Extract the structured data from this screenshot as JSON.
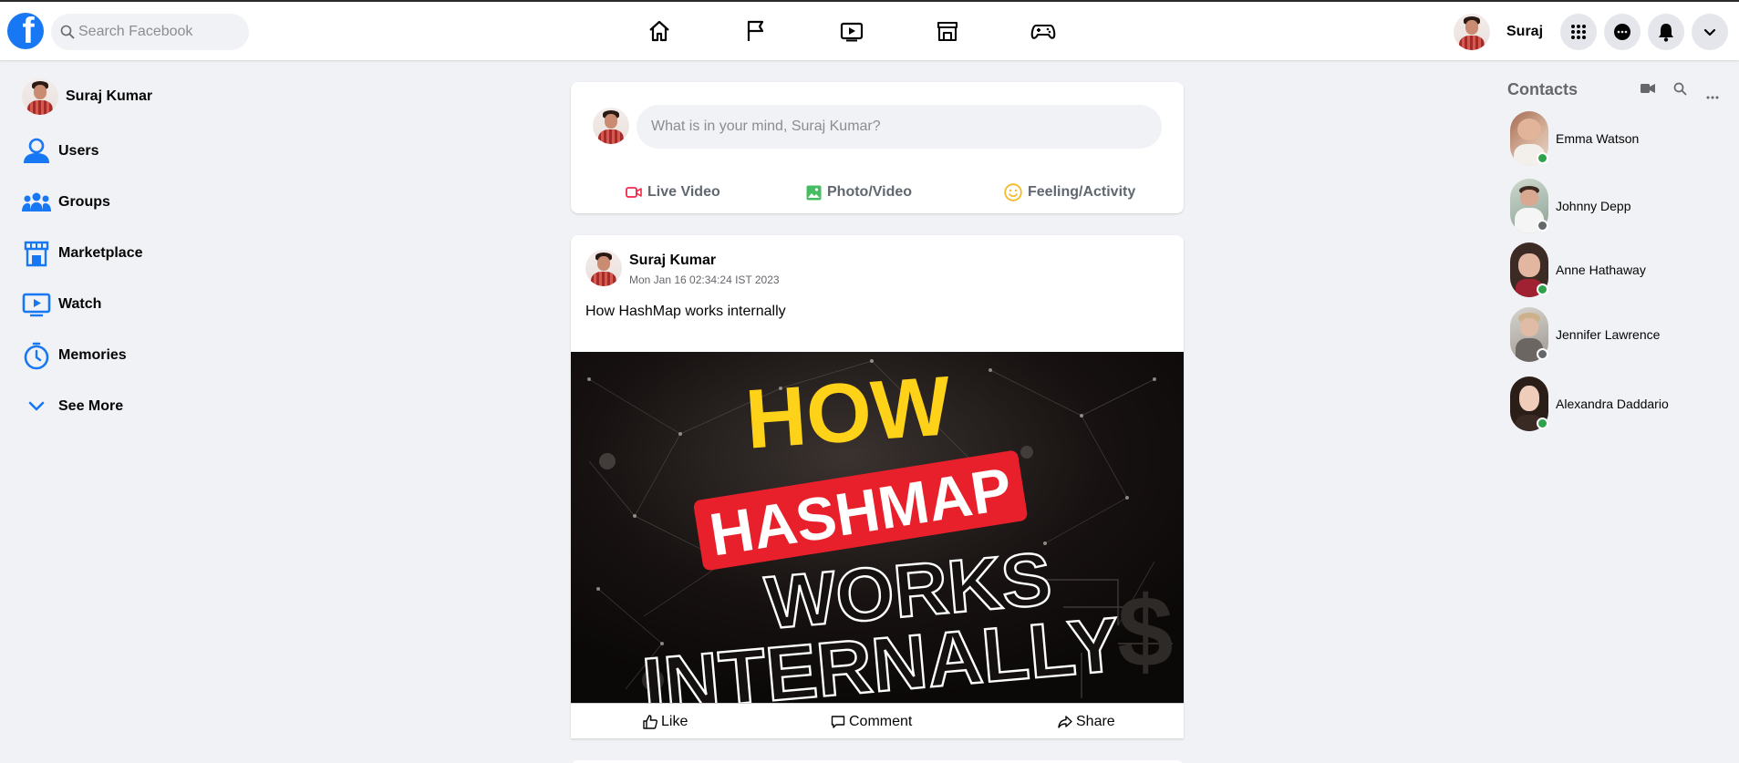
{
  "app": {
    "logo_letter": "f",
    "brand_color": "#1877f2"
  },
  "header": {
    "search": {
      "placeholder": "Search Facebook",
      "value": ""
    },
    "nav_icons": [
      "home-icon",
      "pages-flag-icon",
      "watch-icon",
      "marketplace-icon",
      "gaming-icon"
    ],
    "user_short_name": "Suraj",
    "right_buttons": [
      "menu-grid-icon",
      "messenger-icon",
      "notifications-bell-icon",
      "account-chevron-icon"
    ]
  },
  "sidebar": {
    "profile_name": "Suraj Kumar",
    "items": [
      {
        "label": "Users",
        "icon": "users-icon"
      },
      {
        "label": "Groups",
        "icon": "groups-icon"
      },
      {
        "label": "Marketplace",
        "icon": "marketplace-icon"
      },
      {
        "label": "Watch",
        "icon": "watch-icon"
      },
      {
        "label": "Memories",
        "icon": "memories-clock-icon"
      },
      {
        "label": "See More",
        "icon": "chevron-down-icon"
      }
    ]
  },
  "composer": {
    "placeholder": "What is in your mind, Suraj Kumar?",
    "actions": [
      {
        "label": "Live Video",
        "icon": "live-video-icon",
        "color": "#f02849"
      },
      {
        "label": "Photo/Video",
        "icon": "photo-icon",
        "color": "#45bd62"
      },
      {
        "label": "Feeling/Activity",
        "icon": "feeling-smiley-icon",
        "color": "#f7b928"
      }
    ]
  },
  "post": {
    "author": "Suraj Kumar",
    "timestamp": "Mon Jan 16 02:34:24 IST 2023",
    "text": "How HashMap works internally",
    "image_lines": [
      "HOW",
      "HASHMAP",
      "WORKS",
      "INTERNALLY"
    ],
    "actions": [
      {
        "label": "Like",
        "icon": "like-thumb-icon"
      },
      {
        "label": "Comment",
        "icon": "comment-icon"
      },
      {
        "label": "Share",
        "icon": "share-icon"
      }
    ]
  },
  "contacts": {
    "title": "Contacts",
    "header_icons": [
      "video-call-icon",
      "search-icon",
      "more-options-icon"
    ],
    "items": [
      {
        "name": "Emma Watson",
        "online": true
      },
      {
        "name": "Johnny Depp",
        "online": false
      },
      {
        "name": "Anne Hathaway",
        "online": true
      },
      {
        "name": "Jennifer Lawrence",
        "online": false
      },
      {
        "name": "Alexandra Daddario",
        "online": true
      }
    ],
    "online_color": "#31a24c",
    "offline_color": "#65676b"
  }
}
